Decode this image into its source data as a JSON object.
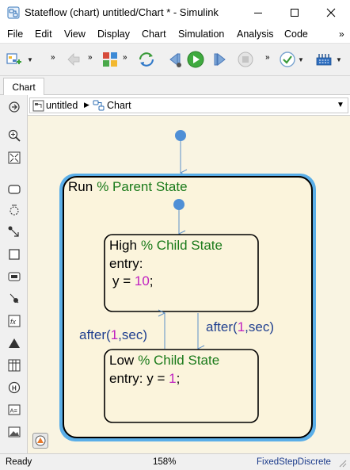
{
  "window": {
    "title": "Stateflow (chart) untitled/Chart * - Simulink"
  },
  "menu": {
    "items": [
      "File",
      "Edit",
      "View",
      "Display",
      "Chart",
      "Simulation",
      "Analysis",
      "Code"
    ],
    "overflow": "»"
  },
  "toolbar": {
    "overflow": "»",
    "icons": [
      "model-browser-icon",
      "back-icon",
      "forward-icon",
      "library-icon",
      "update-icon",
      "step-back-icon",
      "run-icon",
      "step-forward-icon",
      "stop-icon",
      "check-icon",
      "hardware-icon"
    ]
  },
  "tabs": {
    "active": "Chart"
  },
  "breadcrumb": {
    "model": "untitled",
    "chart": "Chart"
  },
  "diagram": {
    "parent_state": {
      "name": "Run",
      "comment": "% Parent State"
    },
    "high_state": {
      "name": "High",
      "comment": "% Child State",
      "line1": "entry:",
      "line2_prefix": "y = ",
      "line2_value": "10",
      "line2_suffix": ";"
    },
    "low_state": {
      "name": "Low",
      "comment": "% Child State",
      "line1_prefix": "entry: y = ",
      "line1_value": "1",
      "line1_suffix": ";"
    },
    "transition_up": {
      "prefix": "after(",
      "value": "1",
      "suffix": ",sec)"
    },
    "transition_down": {
      "prefix": "after(",
      "value": "1",
      "suffix": ",sec)"
    },
    "colors": {
      "comment": "#1a7a1a",
      "number": "#c020c0",
      "transition": "#1f3f8f",
      "state_border": "#5aaee8",
      "default_dot": "#4f8fd6"
    }
  },
  "status": {
    "state": "Ready",
    "zoom": "158%",
    "solver": "FixedStepDiscrete"
  }
}
